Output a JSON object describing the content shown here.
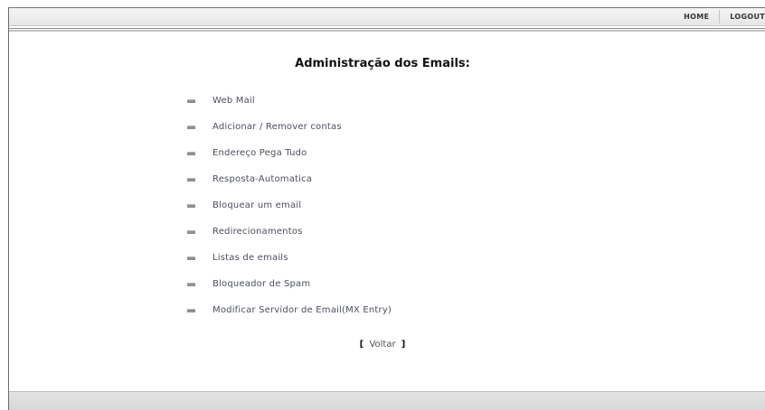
{
  "nav": {
    "home_label": "HOME",
    "logout_label": "LOGOUT"
  },
  "page": {
    "title": "Administração dos Emails:"
  },
  "menu": {
    "items": [
      {
        "label": "Web Mail",
        "icon": "bullet-icon"
      },
      {
        "label": "Adicionar / Remover contas",
        "icon": "bullet-icon"
      },
      {
        "label": "Endereço Pega Tudo",
        "icon": "bullet-icon"
      },
      {
        "label": "Resposta-Automatica",
        "icon": "bullet-icon"
      },
      {
        "label": "Bloquear um email",
        "icon": "bullet-icon"
      },
      {
        "label": "Redirecionamentos",
        "icon": "bullet-icon"
      },
      {
        "label": "Listas de emails",
        "icon": "bullet-icon"
      },
      {
        "label": "Bloqueador de Spam",
        "icon": "bullet-icon"
      },
      {
        "label": "Modificar Servidor de Email(MX Entry)",
        "icon": "bullet-icon"
      }
    ]
  },
  "back": {
    "open_bracket": "[",
    "label": "Voltar",
    "close_bracket": "]"
  },
  "colors": {
    "link": "#4a4f5a",
    "title": "#111111",
    "topbar": "#ececec"
  }
}
